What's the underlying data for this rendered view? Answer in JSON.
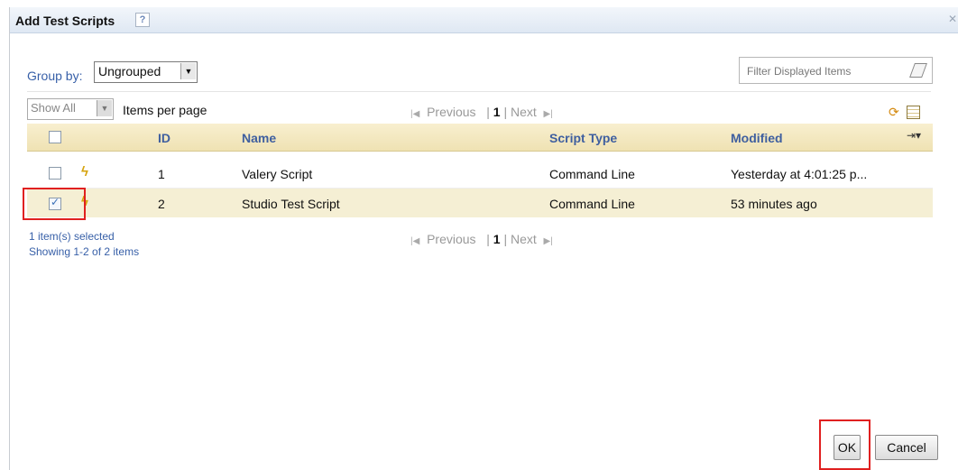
{
  "dialog": {
    "title": "Add Test Scripts",
    "help_icon": "?",
    "close_icon": "✕"
  },
  "toolbar": {
    "group_by_label": "Group by:",
    "group_by_value": "Ungrouped",
    "filter_placeholder": "Filter Displayed Items",
    "show_value": "Show All",
    "items_per_page_label": "Items per page"
  },
  "pager": {
    "first_icon": "|◀",
    "previous": "Previous",
    "current_page": "1",
    "next": "Next",
    "last_icon": "▶|"
  },
  "table": {
    "columns": [
      "ID",
      "Name",
      "Script Type",
      "Modified"
    ],
    "rows": [
      {
        "id": "1",
        "name": "Valery Script",
        "type": "Command Line",
        "modified": "Yesterday at 4:01:25 p...",
        "checked": false
      },
      {
        "id": "2",
        "name": "Studio Test Script",
        "type": "Command Line",
        "modified": "53 minutes ago",
        "checked": true
      }
    ]
  },
  "status": {
    "selected": "1 item(s) selected",
    "showing": "Showing 1-2 of 2 items"
  },
  "buttons": {
    "ok": "OK",
    "cancel": "Cancel"
  },
  "icons": {
    "refresh": "refresh-icon",
    "settings": "table-settings-icon",
    "script": "script-icon",
    "column_menu": "column-menu-icon",
    "eraser": "eraser-icon"
  },
  "colors": {
    "header_bg": "#efe2b3",
    "selected_row_bg": "#f5efd4",
    "link_blue": "#3860a8",
    "highlight_red": "#e02020"
  }
}
